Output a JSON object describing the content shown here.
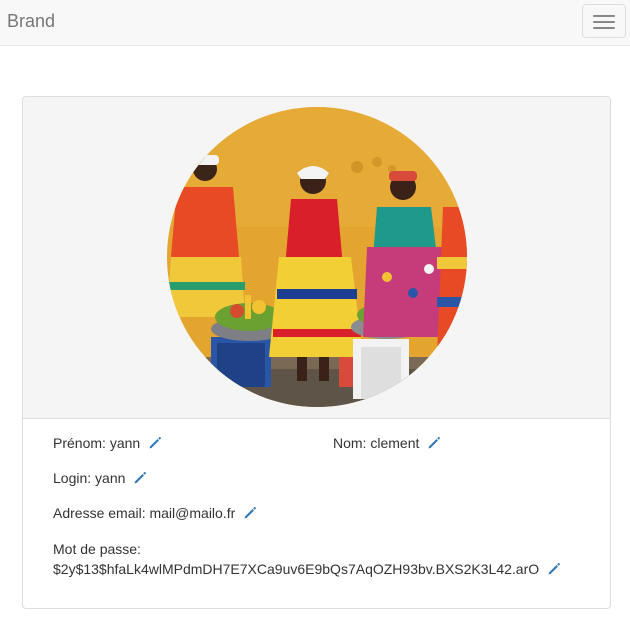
{
  "navbar": {
    "brand": "Brand",
    "toggle_icon": "hamburger-menu-icon"
  },
  "profile": {
    "photo_icon": "profile-photo",
    "fields": {
      "prenom": {
        "label": "Prénom:",
        "value": "yann"
      },
      "nom": {
        "label": "Nom:",
        "value": "clement"
      },
      "login": {
        "label": "Login:",
        "value": "yann"
      },
      "email": {
        "label": "Adresse email:",
        "value": "mail@mailo.fr"
      },
      "password": {
        "label": "Mot de passe:",
        "value": "$2y$13$hfaLk4wlMPdmDH7E7XCa9uv6E9bQs7AqOZH93bv.BXS2K3L42.arO"
      }
    },
    "edit_icon": "pencil-icon"
  },
  "colors": {
    "navbar_bg": "#f8f8f8",
    "panel_head_bg": "#f5f5f5",
    "edit_icon": "#337ab7",
    "wall_yellow": "#e3a530"
  }
}
